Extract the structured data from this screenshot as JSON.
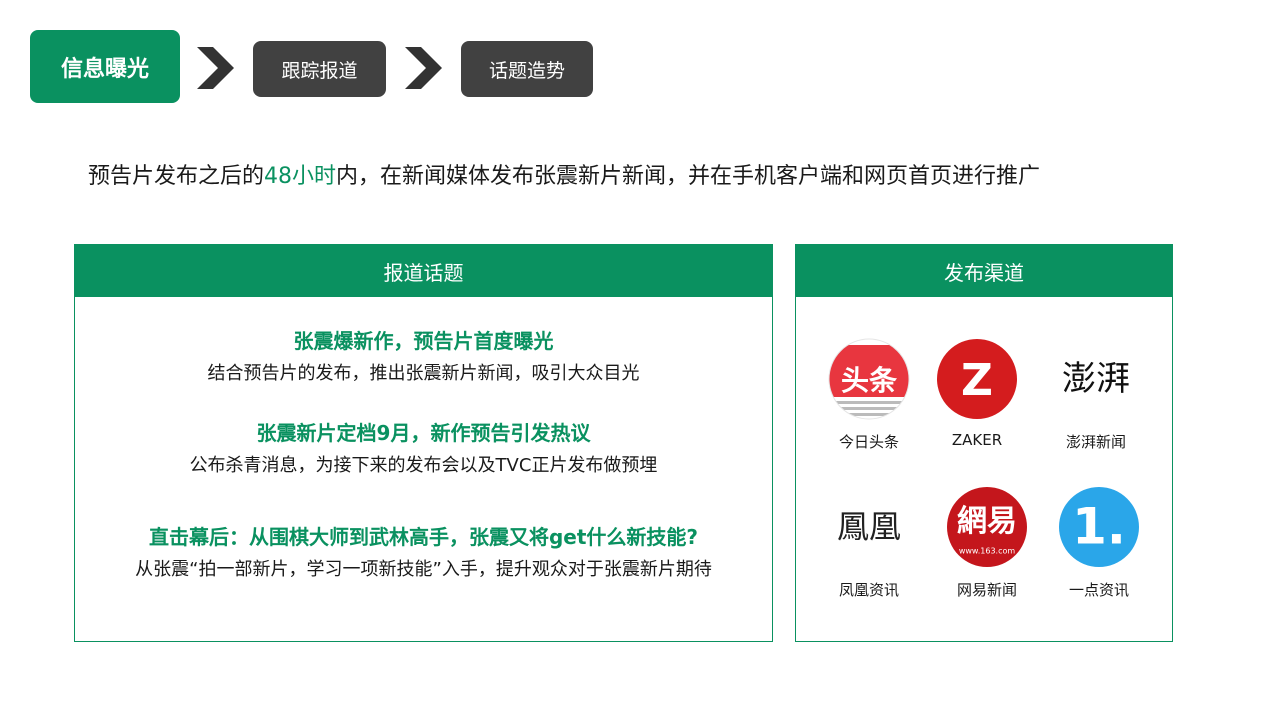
{
  "process_steps": {
    "active": "信息曝光",
    "step2": "跟踪报道",
    "step3": "话题造势"
  },
  "intro": {
    "before": "预告片发布之后的",
    "highlight": "48小时",
    "after": "内，在新闻媒体发布张震新片新闻，并在手机客户端和网页首页进行推广"
  },
  "topics_panel": {
    "header": "报道话题",
    "items": [
      {
        "title": "张震爆新作，预告片首度曝光",
        "desc": "结合预告片的发布，推出张震新片新闻，吸引大众目光"
      },
      {
        "title": "张震新片定档9月，新作预告引发热议",
        "desc": "公布杀青消息，为接下来的发布会以及TVC正片发布做预埋"
      },
      {
        "title": "直击幕后：从围棋大师到武林高手，张震又将get什么新技能?",
        "desc": "从张震“拍一部新片，学习一项新技能”入手，提升观众对于张震新片期待"
      }
    ]
  },
  "channels_panel": {
    "header": "发布渠道",
    "channels": [
      {
        "name": "今日头条",
        "logo_text": "头条",
        "icon": "toutiao-logo-icon"
      },
      {
        "name": "ZAKER",
        "logo_text": "Z",
        "icon": "zaker-logo-icon"
      },
      {
        "name": "澎湃新闻",
        "logo_text": "澎湃",
        "icon": "thepaper-logo-icon"
      },
      {
        "name": "凤凰资讯",
        "logo_text": "鳳凰",
        "icon": "ifeng-logo-icon"
      },
      {
        "name": "网易新闻",
        "logo_text": "網易",
        "logo_subtext": "www.163.com",
        "icon": "netease-logo-icon"
      },
      {
        "name": "一点资讯",
        "logo_text": "1.",
        "icon": "yidian-logo-icon"
      }
    ]
  },
  "colors": {
    "brand_green": "#0a9160",
    "step_dark": "#414141",
    "arrow": "#333333",
    "toutiao_red": "#e8363f",
    "zaker_red": "#d41c1e",
    "netease_red": "#c4161c",
    "yidian_blue": "#2aa6e9"
  }
}
